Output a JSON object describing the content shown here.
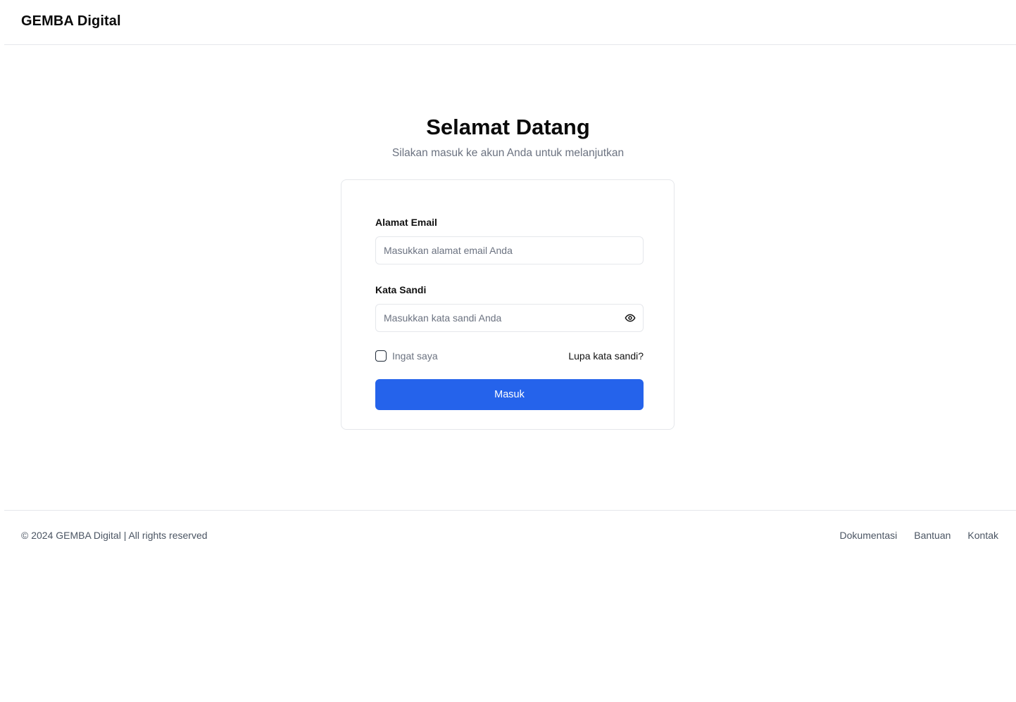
{
  "header": {
    "brand": "GEMBA Digital"
  },
  "welcome": {
    "title": "Selamat Datang",
    "subtitle": "Silakan masuk ke akun Anda untuk melanjutkan"
  },
  "form": {
    "email_label": "Alamat Email",
    "email_placeholder": "Masukkan alamat email Anda",
    "email_value": "",
    "password_label": "Kata Sandi",
    "password_placeholder": "Masukkan kata sandi Anda",
    "password_value": "",
    "password_toggle_icon": "eye-icon",
    "remember_label": "Ingat saya",
    "remember_checked": false,
    "forgot_label": "Lupa kata sandi?",
    "submit_label": "Masuk"
  },
  "footer": {
    "copyright": "© 2024 GEMBA Digital | All rights reserved",
    "links": [
      {
        "label": "Dokumentasi"
      },
      {
        "label": "Bantuan"
      },
      {
        "label": "Kontak"
      }
    ]
  },
  "colors": {
    "primary": "#2563eb",
    "border": "#e5e7eb",
    "muted_text": "#6b7280",
    "text": "#111111"
  }
}
